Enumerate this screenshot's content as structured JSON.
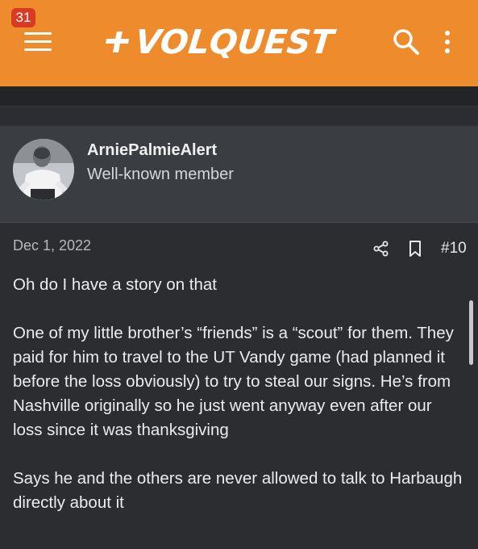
{
  "header": {
    "notification_count": "31",
    "logo_text": "VOLQUEST",
    "brand_color": "#ee8c2d"
  },
  "user": {
    "name": "ArniePalmieAlert",
    "title": "Well-known member"
  },
  "post": {
    "date": "Dec 1, 2022",
    "number": "#10",
    "paragraphs": [
      "Oh do I have a story on that",
      "One of my little brother’s “friends” is a “scout” for them. They paid for him to travel to the UT Vandy game (had planned it before the loss obviously) to try to steal our signs. He’s from Nashville originally so he just went anyway even after our loss since it was thanksgiving",
      "Says he and the others are never allowed to talk to Harbaugh directly about it"
    ]
  }
}
